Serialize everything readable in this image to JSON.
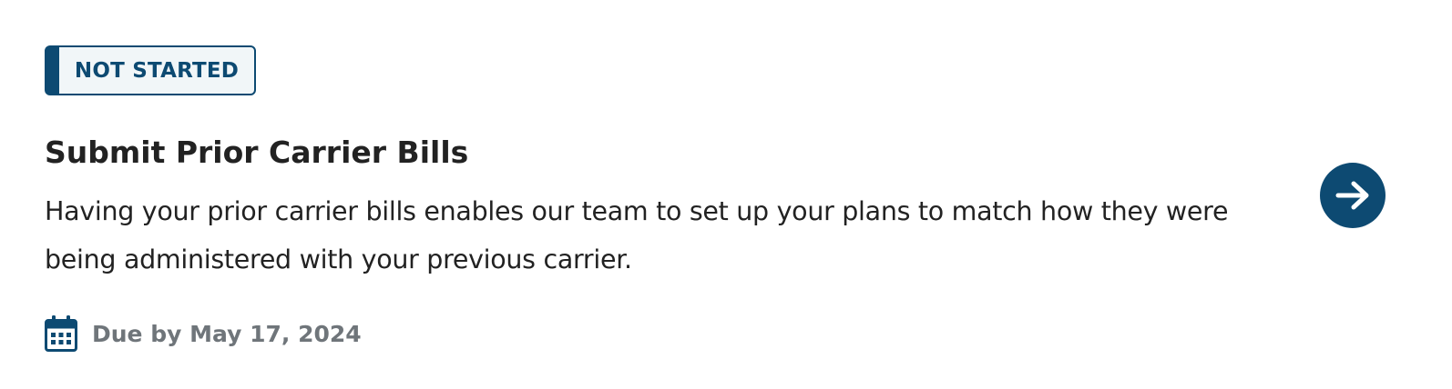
{
  "task": {
    "status": "NOT STARTED",
    "title": "Submit Prior Carrier Bills",
    "description": "Having your prior carrier bills enables our team to set up your plans to match how they were being administered with your previous carrier.",
    "due": "Due by May 17, 2024",
    "icons": {
      "due": "calendar-icon",
      "action": "arrow-right-icon"
    }
  },
  "colors": {
    "accent": "#0d4a72",
    "badge_background": "#f1f6f8",
    "title_text": "#222222",
    "due_text": "#6f757a"
  }
}
